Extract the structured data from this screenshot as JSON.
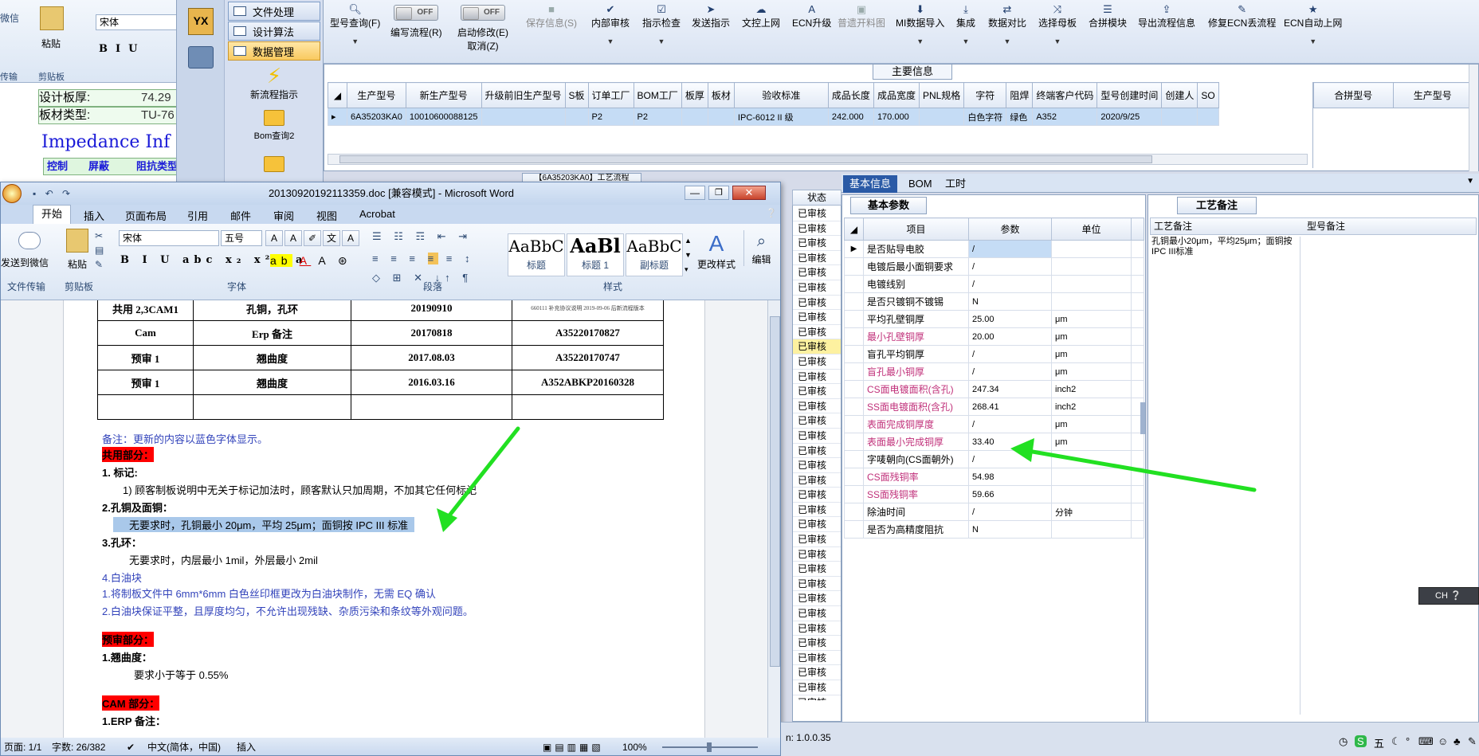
{
  "bgword": {
    "labels": [
      "粘贴",
      "剪贴板",
      "传输"
    ],
    "font": "宋体",
    "doc_lines": [
      {
        "label": "设计板厚:",
        "value": "74.29"
      },
      {
        "label": "板材类型:",
        "value": "TU-76"
      }
    ],
    "impedance_title": "Impedance Inf",
    "cols": [
      "控制",
      "屏蔽",
      "阻抗类型"
    ]
  },
  "nav": {
    "items": [
      {
        "label": "文件处理",
        "active": false
      },
      {
        "label": "设计算法",
        "active": false
      },
      {
        "label": "数据管理",
        "active": true
      }
    ],
    "big": [
      "新流程指示",
      "Bom查询2"
    ],
    "logo": "YX"
  },
  "toolbar": {
    "items": [
      {
        "label": "型号查询(F)",
        "icon": "search-icon",
        "enabled": true
      },
      {
        "label": "编写流程(R)",
        "toggle": "OFF",
        "enabled": true
      },
      {
        "label": "启动修改(E)",
        "toggle": "OFF",
        "sub": "取消(Z)",
        "enabled": true
      },
      {
        "label": "保存信息(S)",
        "icon": "save-icon",
        "enabled": false
      },
      {
        "label": "内部审核",
        "icon": "check-icon",
        "enabled": true
      },
      {
        "label": "指示检查",
        "icon": "check-icon",
        "enabled": true
      },
      {
        "label": "发送指示",
        "icon": "send-icon",
        "enabled": true
      },
      {
        "label": "文控上网",
        "icon": "cloud-icon",
        "enabled": true
      },
      {
        "label": "ECN升级",
        "icon": "upgrade-icon",
        "enabled": true
      },
      {
        "label": "普遗开料图",
        "icon": "image-icon",
        "enabled": false
      },
      {
        "label": "MI数据导入",
        "icon": "import-icon",
        "enabled": true
      },
      {
        "label": "集成",
        "icon": "download-icon",
        "enabled": true
      },
      {
        "label": "数据对比",
        "icon": "compare-icon",
        "enabled": true
      },
      {
        "label": "选择母板",
        "icon": "shuffle-icon",
        "enabled": true
      },
      {
        "label": "合拼模块",
        "icon": "list-icon",
        "enabled": true
      },
      {
        "label": "导出流程信息",
        "icon": "export-icon",
        "enabled": true
      },
      {
        "label": "修复ECN丢流程",
        "icon": "repair-icon",
        "enabled": true
      },
      {
        "label": "ECN自动上网",
        "icon": "star-icon",
        "enabled": true
      }
    ]
  },
  "main": {
    "title": "主要信息",
    "columns": [
      "生产型号",
      "新生产型号",
      "升级前旧生产型号",
      "S板",
      "订单工厂",
      "BOM工厂",
      "板厚",
      "板材",
      "验收标准",
      "成品长度",
      "成品宽度",
      "PNL规格",
      "字符",
      "阻焊",
      "终端客户代码",
      "型号创建时间",
      "创建人",
      "SO"
    ],
    "row": [
      "6A35203KA0",
      "10010600088125",
      "",
      "",
      "P2",
      "P2",
      "",
      "",
      "IPC-6012 II 级",
      "242.000",
      "170.000",
      "",
      "白色字符",
      "绿色",
      "A352",
      "2020/9/25",
      "",
      ""
    ],
    "right_cols": [
      "合拼型号",
      "生产型号"
    ],
    "flow_tab": "【6A35203KA0】工艺流程"
  },
  "status": {
    "header": "状态",
    "cells": [
      "已审核",
      "已审核",
      "已审核",
      "已审核",
      "已审核",
      "已审核",
      "已审核",
      "已审核",
      "已审核",
      "已审核",
      "已审核",
      "已审核",
      "已审核",
      "已审核",
      "已审核",
      "已审核",
      "已审核",
      "已审核",
      "已审核",
      "已审核",
      "已审核",
      "已审核",
      "已审核",
      "已审核",
      "已审核",
      "已审核",
      "已审核",
      "已审核",
      "已审核",
      "已审核",
      "已审核",
      "已审核",
      "已审核",
      "已审核",
      "已审核"
    ],
    "highlight_index": 9
  },
  "tabs": [
    "基本信息",
    "BOM",
    "工时"
  ],
  "params": {
    "title": "基本参数",
    "headers": [
      "项目",
      "参数",
      "单位"
    ],
    "rows": [
      {
        "item": "是否贴导电胶",
        "value": "/",
        "unit": "",
        "pink": false
      },
      {
        "item": "电镀后最小面铜要求",
        "value": "/",
        "unit": "",
        "pink": false
      },
      {
        "item": "电镀线别",
        "value": "/",
        "unit": "",
        "pink": false
      },
      {
        "item": "是否只镀铜不镀锡",
        "value": "N",
        "unit": "",
        "pink": false
      },
      {
        "item": "平均孔壁铜厚",
        "value": "25.00",
        "unit": "μm",
        "pink": false
      },
      {
        "item": "最小孔壁铜厚",
        "value": "20.00",
        "unit": "μm",
        "pink": true
      },
      {
        "item": "盲孔平均铜厚",
        "value": "/",
        "unit": "μm",
        "pink": false
      },
      {
        "item": "盲孔最小铜厚",
        "value": "/",
        "unit": "μm",
        "pink": true
      },
      {
        "item": "CS面电镀面积(含孔)",
        "value": "247.34",
        "unit": "inch2",
        "pink": true
      },
      {
        "item": "SS面电镀面积(含孔)",
        "value": "268.41",
        "unit": "inch2",
        "pink": true
      },
      {
        "item": "表面完成铜厚度",
        "value": "/",
        "unit": "μm",
        "pink": true
      },
      {
        "item": "表面最小完成铜厚",
        "value": "33.40",
        "unit": "μm",
        "pink": true
      },
      {
        "item": "字唛朝向(CS面朝外)",
        "value": "/",
        "unit": "",
        "pink": false
      },
      {
        "item": "CS面残铜率",
        "value": "54.98",
        "unit": "",
        "pink": true
      },
      {
        "item": "SS面残铜率",
        "value": "59.66",
        "unit": "",
        "pink": true
      },
      {
        "item": "除油时间",
        "value": "/",
        "unit": "分钟",
        "pink": false
      },
      {
        "item": "是否为高精度阻抗",
        "value": "N",
        "unit": "",
        "pink": false
      }
    ]
  },
  "notes": {
    "title": "工艺备注",
    "headers": [
      "工艺备注",
      "型号备注"
    ],
    "text": "孔铜最小20μm，平均25μm；面铜按IPC III标准"
  },
  "word": {
    "title": "20130920192113359.doc [兼容模式] - Microsoft Word",
    "tabs": [
      "开始",
      "插入",
      "页面布局",
      "引用",
      "邮件",
      "审阅",
      "视图",
      "Acrobat"
    ],
    "left_labels": [
      "发送到微信",
      "文件传输"
    ],
    "clipboard": [
      "粘贴",
      "剪贴板"
    ],
    "font": "宋体",
    "size": "五号",
    "groups": [
      "字体",
      "段落",
      "样式"
    ],
    "styles": [
      {
        "sample": "AaBbC",
        "name": "标题"
      },
      {
        "sample": "AaBl",
        "name": "标题 1"
      },
      {
        "sample": "AaBbC",
        "name": "副标题"
      }
    ],
    "change_style": "更改样式",
    "edit": "编辑",
    "table": [
      [
        "共用 2,3CAM1",
        "孔铜，孔环",
        "20190910",
        "660111 补充协议说明 2019-09-06 后新流程版本"
      ],
      [
        "Cam",
        "Erp 备注",
        "20170818",
        "A35220170827"
      ],
      [
        "预审 1",
        "翘曲度",
        "2017.08.03",
        "A35220170747"
      ],
      [
        "预审 1",
        "翘曲度",
        "2016.03.16",
        "A352ABKP20160328"
      ]
    ],
    "note": "备注：更新的内容以蓝色字体显示。",
    "shared": "共用部分：",
    "l1": "1.    标记:",
    "l1a": "1)  顾客制板说明中无关于标记加法时，顾客默认只加周期，不加其它任何标记",
    "l2": "2.孔铜及面铜：",
    "l2a": "无要求时，孔铜最小 20μm，平均 25μm；面铜按 IPC III 标准",
    "l3": "3.孔环：",
    "l3a": "无要求时，内层最小 1mil，外层最小 2mil",
    "l4": "4.白油块",
    "l4a": "1.将制板文件中 6mm*6mm 白色丝印框更改为白油块制作，无需 EQ 确认",
    "l4b": "2.白油块保证平整，且厚度均匀，不允许出现残缺、杂质污染和条纹等外观问题。",
    "pre": "预审部分：",
    "p1": "1.翘曲度：",
    "p1a": "要求小于等于 0.55%",
    "cam": "CAM 部分：",
    "c1": "1.ERP 备注：",
    "status": {
      "page": "页面: 1/1",
      "words": "字数: 26/382",
      "lang": "中文(简体，中国)",
      "mode": "插入",
      "zoom": "100%"
    }
  },
  "version": "n: 1.0.0.35",
  "tray": {
    "ime": "CH",
    "ime2": "五"
  },
  "arrow_color": "#22e022"
}
